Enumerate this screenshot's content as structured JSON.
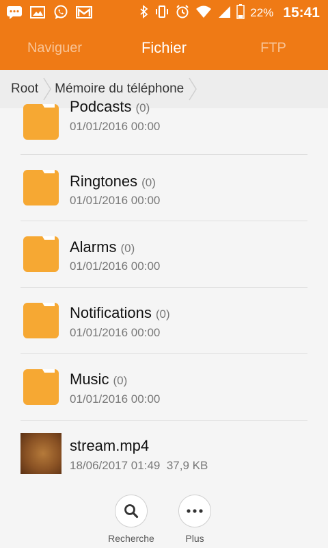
{
  "status_bar": {
    "battery_text": "22%",
    "time": "15:41",
    "left_icons": [
      "message-icon",
      "image-icon",
      "whatsapp-icon",
      "gmail-icon"
    ],
    "right_icons": [
      "bluetooth-icon",
      "vibrate-icon",
      "alarm-icon",
      "wifi-icon",
      "signal-icon",
      "battery-icon"
    ]
  },
  "tabs": [
    {
      "label": "Naviguer",
      "active": false
    },
    {
      "label": "Fichier",
      "active": true
    },
    {
      "label": "FTP",
      "active": false
    }
  ],
  "breadcrumb": [
    "Root",
    "Mémoire du téléphone"
  ],
  "items": [
    {
      "name": "Podcasts",
      "count": "(0)",
      "date": "01/01/2016 00:00",
      "type": "folder"
    },
    {
      "name": "Ringtones",
      "count": "(0)",
      "date": "01/01/2016 00:00",
      "type": "folder"
    },
    {
      "name": "Alarms",
      "count": "(0)",
      "date": "01/01/2016 00:00",
      "type": "folder"
    },
    {
      "name": "Notifications",
      "count": "(0)",
      "date": "01/01/2016 00:00",
      "type": "folder"
    },
    {
      "name": "Music",
      "count": "(0)",
      "date": "01/01/2016 00:00",
      "type": "folder"
    },
    {
      "name": "stream.mp4",
      "date": "18/06/2017 01:49",
      "size": "37,9 KB",
      "type": "video"
    }
  ],
  "bottom_bar": {
    "search_label": "Recherche",
    "more_label": "Plus"
  },
  "colors": {
    "accent": "#ef7a15",
    "folder": "#f6a833"
  }
}
